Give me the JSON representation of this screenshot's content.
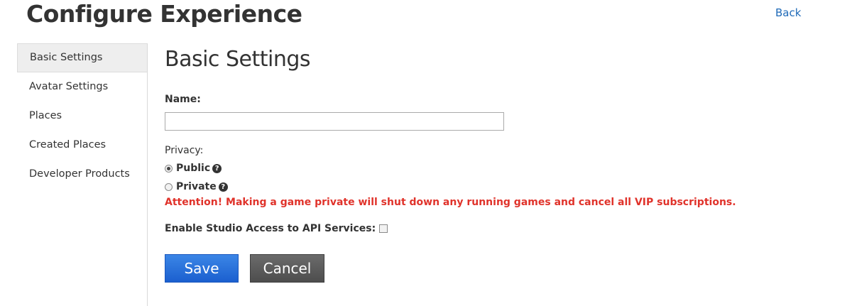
{
  "header": {
    "title": "Configure Experience",
    "back_label": "Back"
  },
  "sidebar": {
    "items": [
      {
        "label": "Basic Settings",
        "active": true
      },
      {
        "label": "Avatar Settings",
        "active": false
      },
      {
        "label": "Places",
        "active": false
      },
      {
        "label": "Created Places",
        "active": false
      },
      {
        "label": "Developer Products",
        "active": false
      }
    ]
  },
  "form": {
    "section_title": "Basic Settings",
    "name_label": "Name:",
    "name_value": "",
    "privacy_label": "Privacy:",
    "privacy_options": [
      {
        "label": "Public",
        "selected": true
      },
      {
        "label": "Private",
        "selected": false
      }
    ],
    "warning_text": "Attention! Making a game private will shut down any running games and cancel all VIP subscriptions.",
    "studio_access_label": "Enable Studio Access to API Services:",
    "studio_access_checked": false,
    "save_label": "Save",
    "cancel_label": "Cancel"
  },
  "icons": {
    "help": "question-circle-icon"
  },
  "colors": {
    "link": "#1f6ab8",
    "warning": "#e0332b",
    "save_button": "#2a6fdc",
    "cancel_button": "#5a5a5a"
  }
}
